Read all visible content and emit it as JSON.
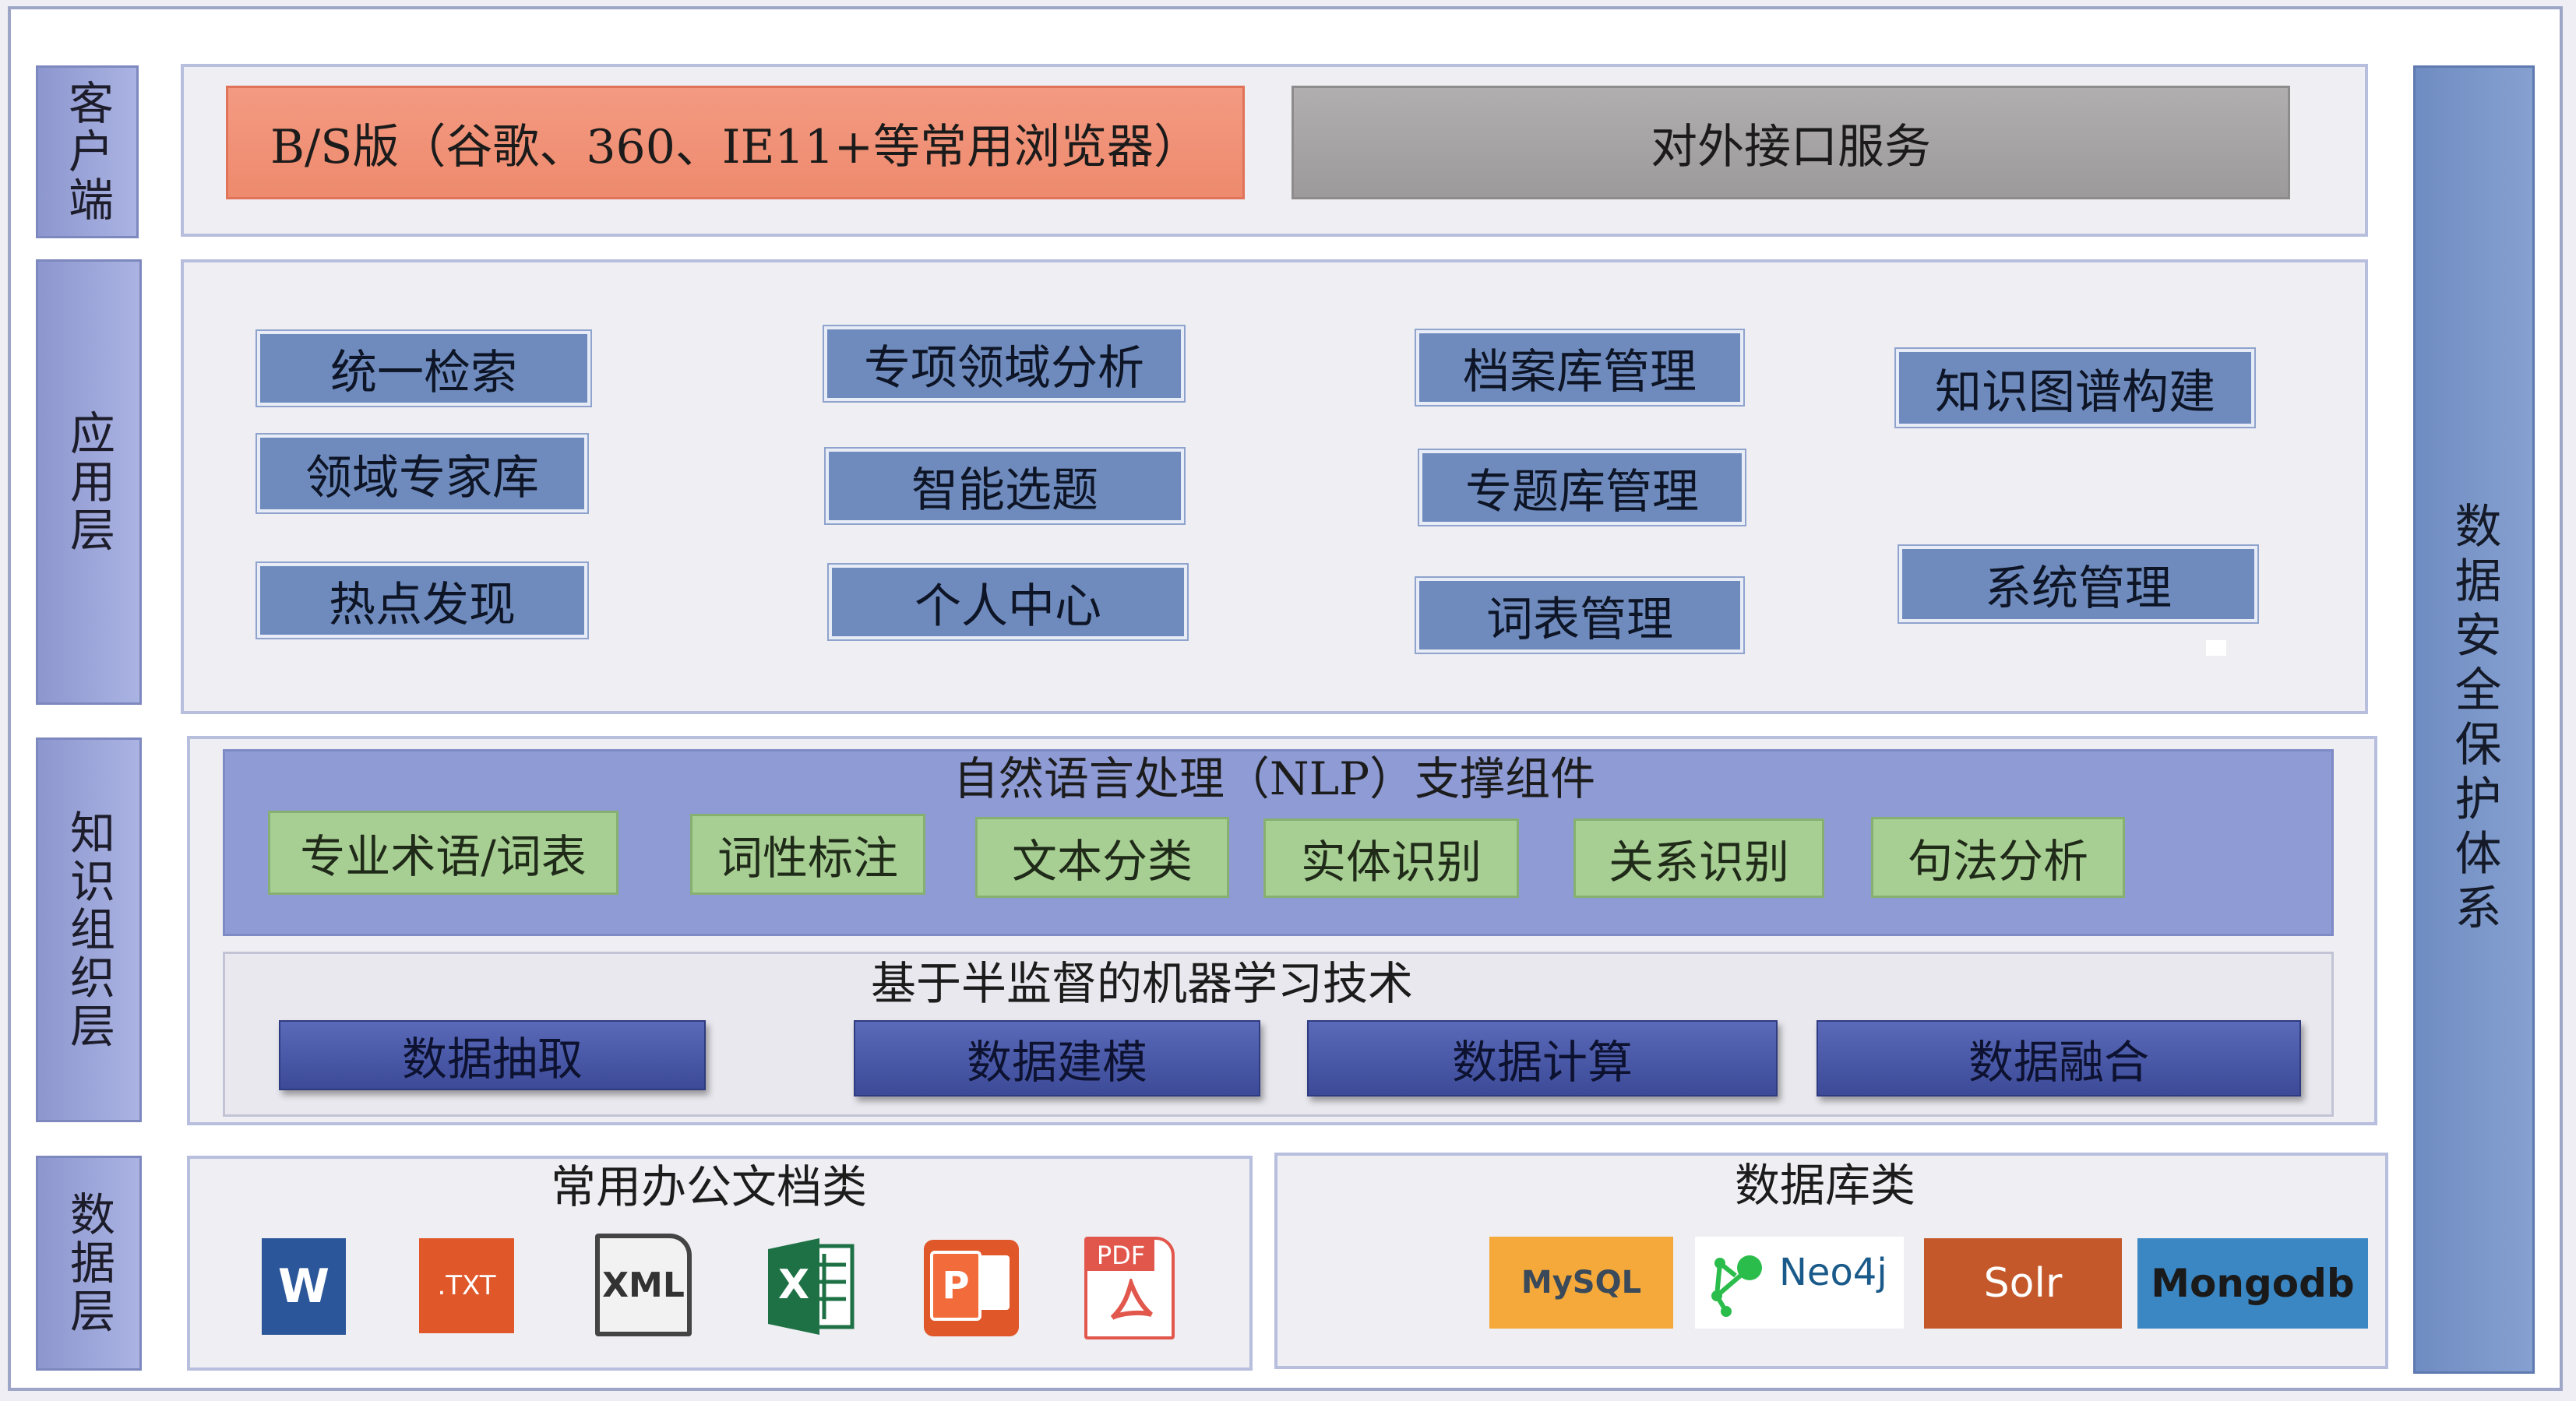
{
  "layers": {
    "client": "客户端",
    "application": "应用层",
    "knowledge": "知识组织层",
    "data": "数据层"
  },
  "right_label": "数据安全保护体系",
  "client": {
    "browser": "B/S版（谷歌、360、IE11+等常用浏览器）",
    "api": "对外接口服务"
  },
  "application": {
    "col1": [
      "统一检索",
      "领域专家库",
      "热点发现"
    ],
    "col2": [
      "专项领域分析",
      "智能选题",
      "个人中心"
    ],
    "col3": [
      "档案库管理",
      "专题库管理",
      "词表管理"
    ],
    "col4": [
      "知识图谱构建",
      "系统管理"
    ]
  },
  "nlp": {
    "title": "自然语言处理（NLP）支撑组件",
    "items": [
      "专业术语/词表",
      "词性标注",
      "文本分类",
      "实体识别",
      "关系识别",
      "句法分析"
    ]
  },
  "ml": {
    "title": "基于半监督的机器学习技术",
    "items": [
      "数据抽取",
      "数据建模",
      "数据计算",
      "数据融合"
    ]
  },
  "office": {
    "title": "常用办公文档类",
    "icons": [
      {
        "name": "word-icon",
        "label": "W",
        "color": "#2b579a"
      },
      {
        "name": "txt-icon",
        "label": ".TXT",
        "color": "#e0572a"
      },
      {
        "name": "xml-icon",
        "label": "XML",
        "color": "#444444"
      },
      {
        "name": "excel-icon",
        "label": "X",
        "color": "#1e7145"
      },
      {
        "name": "powerpoint-icon",
        "label": "P",
        "color": "#e0572a"
      },
      {
        "name": "pdf-icon",
        "label": "PDF",
        "color": "#e2574c"
      }
    ]
  },
  "database": {
    "title": "数据库类",
    "items": [
      {
        "name": "mysql-logo",
        "label": "MySQL",
        "color": "#f5a93a"
      },
      {
        "name": "neo4j-logo",
        "label": "Neo4j",
        "color": "#ffffff"
      },
      {
        "name": "solr-logo",
        "label": "Solr",
        "color": "#c4582a"
      },
      {
        "name": "mongodb-logo",
        "label": "Mongodb",
        "color": "#3b87c4"
      }
    ]
  }
}
